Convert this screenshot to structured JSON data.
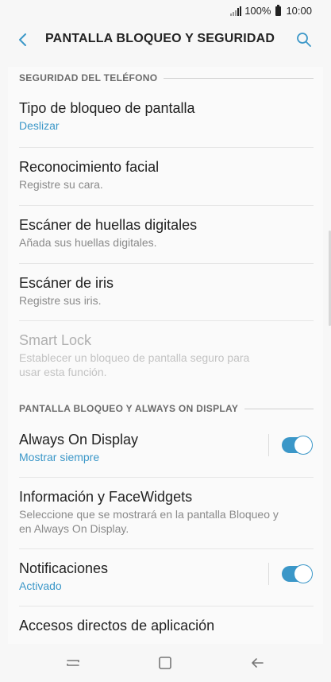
{
  "status": {
    "battery": "100%",
    "time": "10:00"
  },
  "appbar": {
    "title": "PANTALLA BLOQUEO Y SEGURIDAD"
  },
  "sections": {
    "phone_security": {
      "header": "SEGURIDAD DEL TELÉFONO",
      "items": [
        {
          "title": "Tipo de bloqueo de pantalla",
          "sub": "Deslizar"
        },
        {
          "title": "Reconocimiento facial",
          "sub": "Registre su cara."
        },
        {
          "title": "Escáner de huellas digitales",
          "sub": "Añada sus huellas digitales."
        },
        {
          "title": "Escáner de iris",
          "sub": "Registre sus iris."
        },
        {
          "title": "Smart Lock",
          "sub_line1": "Establecer un bloqueo de pantalla seguro para",
          "sub_line2": "usar esta función."
        }
      ]
    },
    "lock_aod": {
      "header": "PANTALLA BLOQUEO Y ALWAYS ON DISPLAY",
      "items": [
        {
          "title": "Always On Display",
          "sub": "Mostrar siempre",
          "toggle": true
        },
        {
          "title": "Información y FaceWidgets",
          "sub_line1": "Seleccione que se mostrará en la pantalla Bloqueo y",
          "sub_line2": "en Always On Display."
        },
        {
          "title": "Notificaciones",
          "sub": "Activado",
          "toggle": true
        },
        {
          "title": "Accesos directos de aplicación"
        }
      ]
    }
  },
  "colors": {
    "accent": "#3b97c8",
    "background": "#f7f7f7"
  }
}
